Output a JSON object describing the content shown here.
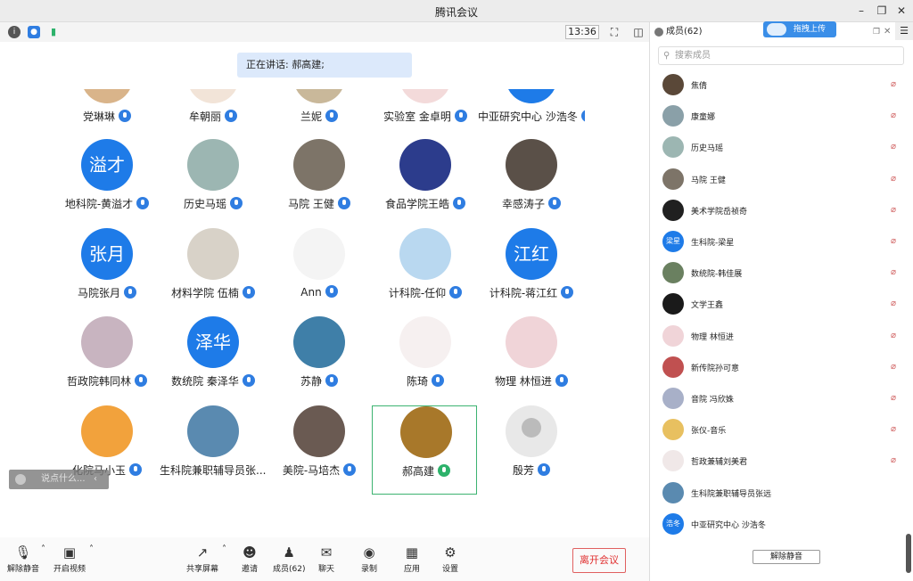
{
  "window": {
    "title": "腾讯会议"
  },
  "status": {
    "time": "13:36"
  },
  "speaking": "正在讲话: 郝高建;",
  "chat_placeholder": "说点什么...",
  "tiles": [
    {
      "name": "党琳琳",
      "avatar": "photo",
      "color": "#d9b48a",
      "mic": "on"
    },
    {
      "name": "牟朝丽",
      "avatar": "photo",
      "color": "#f2e4d8",
      "mic": "on"
    },
    {
      "name": "兰妮",
      "avatar": "photo",
      "color": "#c9b89a",
      "mic": "on"
    },
    {
      "name": "实验室 金卓明",
      "avatar": "photo",
      "color": "#f3dada",
      "mic": "on"
    },
    {
      "name": "中亚研究中心 沙浩冬",
      "avatar": "",
      "color": "#1e7be8",
      "mic": "on"
    },
    {
      "name": "地科院-黄溢才",
      "avatar": "溢才",
      "color": "#1e7be8",
      "mic": "on"
    },
    {
      "name": "历史马瑶",
      "avatar": "photo",
      "color": "#9cb6b2",
      "mic": "on"
    },
    {
      "name": "马院  王健",
      "avatar": "photo",
      "color": "#7d7468",
      "mic": "on"
    },
    {
      "name": "食品学院王皓",
      "avatar": "photo",
      "color": "#2c3c8c",
      "mic": "on"
    },
    {
      "name": "幸感涛子",
      "avatar": "photo",
      "color": "#5a5048",
      "mic": "on"
    },
    {
      "name": "马院张月",
      "avatar": "张月",
      "color": "#1e7be8",
      "mic": "on"
    },
    {
      "name": "材料学院 伍楠",
      "avatar": "photo",
      "color": "#d8d2c8",
      "mic": "on"
    },
    {
      "name": "Ann",
      "avatar": "photo",
      "color": "#f4f4f4",
      "mic": "on"
    },
    {
      "name": "计科院-任仰",
      "avatar": "photo",
      "color": "#b9d8f0",
      "mic": "on"
    },
    {
      "name": "计科院-蒋江红",
      "avatar": "江红",
      "color": "#1e7be8",
      "mic": "on"
    },
    {
      "name": "哲政院韩同林",
      "avatar": "photo",
      "color": "#c8b4c0",
      "mic": "on"
    },
    {
      "name": "数统院 秦泽华",
      "avatar": "泽华",
      "color": "#1e7be8",
      "mic": "on"
    },
    {
      "name": "苏静",
      "avatar": "photo",
      "color": "#3f7fa8",
      "mic": "on"
    },
    {
      "name": "陈琦",
      "avatar": "photo",
      "color": "#f6f0f0",
      "mic": "on"
    },
    {
      "name": "物理 林恒进",
      "avatar": "photo",
      "color": "#f0d4d8",
      "mic": "on"
    },
    {
      "name": "化院马小玉",
      "avatar": "photo",
      "color": "#f2a23c",
      "mic": "on"
    },
    {
      "name": "生科院兼职辅导员张...",
      "avatar": "photo",
      "color": "#5a8ab0",
      "mic": "on"
    },
    {
      "name": "美院-马培杰",
      "avatar": "photo",
      "color": "#6a5a52",
      "mic": "on"
    },
    {
      "name": "郝高建",
      "avatar": "photo",
      "color": "#a8782a",
      "mic": "green"
    },
    {
      "name": "殷芳",
      "avatar": "default",
      "color": "#e8e8e8",
      "mic": "on"
    }
  ],
  "toolbar": {
    "unmute": "解除静音",
    "video": "开启视频",
    "share": "共享屏幕",
    "invite": "邀请",
    "members": "成员(62)",
    "chat": "聊天",
    "record": "录制",
    "apps": "应用",
    "settings": "设置",
    "leave": "离开会议"
  },
  "panel": {
    "title": "成员(62)",
    "upload": "拖拽上传",
    "search_placeholder": "搜索成员",
    "unmute_all": "解除静音",
    "members": [
      {
        "name": "焦倩",
        "avatar": "photo",
        "color": "#5a4838",
        "muted": true
      },
      {
        "name": "康童娜",
        "avatar": "photo",
        "color": "#8aa0a8",
        "muted": true
      },
      {
        "name": "历史马瑶",
        "avatar": "photo",
        "color": "#9cb6b2",
        "muted": true
      },
      {
        "name": "马院  王健",
        "avatar": "photo",
        "color": "#7d7468",
        "muted": true
      },
      {
        "name": "美术学院岳祯奇",
        "avatar": "photo",
        "color": "#202020",
        "muted": true
      },
      {
        "name": "生科院-梁星",
        "avatar": "梁星",
        "color": "#1e7be8",
        "muted": true
      },
      {
        "name": "数统院-韩佳展",
        "avatar": "photo",
        "color": "#6a8060",
        "muted": true
      },
      {
        "name": "文学王鑫",
        "avatar": "photo",
        "color": "#1a1a1a",
        "muted": true
      },
      {
        "name": "物理 林恒进",
        "avatar": "photo",
        "color": "#f0d4d8",
        "muted": true
      },
      {
        "name": "新传院孙可意",
        "avatar": "photo",
        "color": "#c05050",
        "muted": true
      },
      {
        "name": "音院 冯欣姝",
        "avatar": "photo",
        "color": "#a8b0c8",
        "muted": true
      },
      {
        "name": "张仪-音乐",
        "avatar": "photo",
        "color": "#e8c060",
        "muted": true
      },
      {
        "name": "哲政兼辅刘美君",
        "avatar": "photo",
        "color": "#f0e8e8",
        "muted": true
      },
      {
        "name": "生科院兼职辅导员张远",
        "avatar": "photo",
        "color": "#5a8ab0",
        "muted": false
      },
      {
        "name": "中亚研究中心 沙浩冬",
        "avatar": "浩冬",
        "color": "#1e7be8",
        "muted": false
      }
    ]
  }
}
